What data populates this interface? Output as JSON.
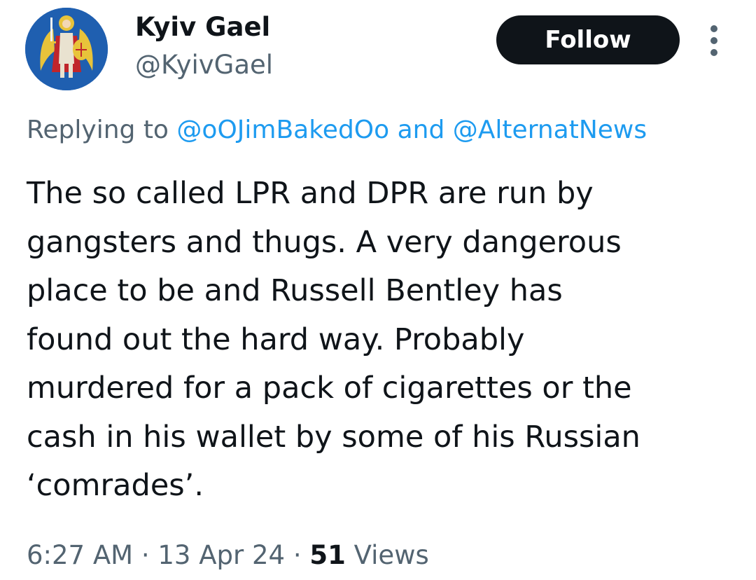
{
  "tweet": {
    "author": {
      "display_name": "Kyiv Gael",
      "handle": "@KyivGael",
      "avatar_icon": "archangel-michael-coat-of-arms-icon"
    },
    "follow_label": "Follow",
    "reply_to": {
      "prefix": "Replying to",
      "mentions": [
        "@oOJimBakedOo",
        "@AlternatNews"
      ],
      "separator": "and"
    },
    "text_lines": [
      "The so called LPR and DPR are run by",
      "gangsters and thugs. A very dangerous",
      "place to be and Russell Bentley has",
      "found out the hard way. Probably",
      "murdered for a pack of cigarettes or the",
      "cash in his wallet by some of his Russian",
      "‘comrades’."
    ],
    "time": "6:27 AM",
    "date": "13 Apr 24",
    "dot": "·",
    "views_count": "51",
    "views_label": "Views"
  },
  "colors": {
    "text_primary": "#0f1419",
    "text_secondary": "#536471",
    "link": "#1d9bf0",
    "follow_bg": "#0f1419",
    "avatar_blue": "#1f5fb0",
    "avatar_gold": "#e8c33a",
    "avatar_red": "#c0252b"
  }
}
